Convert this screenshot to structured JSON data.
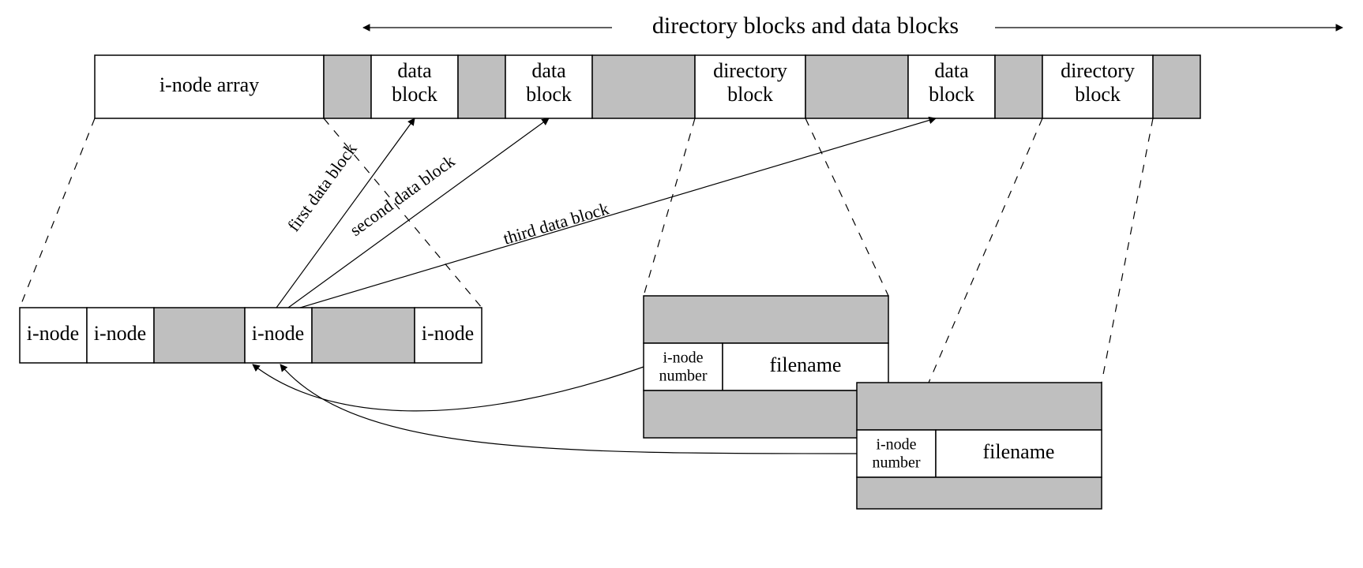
{
  "header": "directory blocks and data blocks",
  "disk": {
    "inode_array": "i-node array",
    "slots": [
      "data\nblock",
      "data\nblock",
      "directory\nblock",
      "data\nblock",
      "directory\nblock"
    ]
  },
  "inodes": {
    "labels": [
      "i-node",
      "i-node",
      "i-node",
      "i-node"
    ]
  },
  "arrows": {
    "first": "first data block",
    "second": "second data block",
    "third": "third data block"
  },
  "dir_entry": {
    "col1_a": "i-node",
    "col1_b": "number",
    "col2": "filename"
  }
}
